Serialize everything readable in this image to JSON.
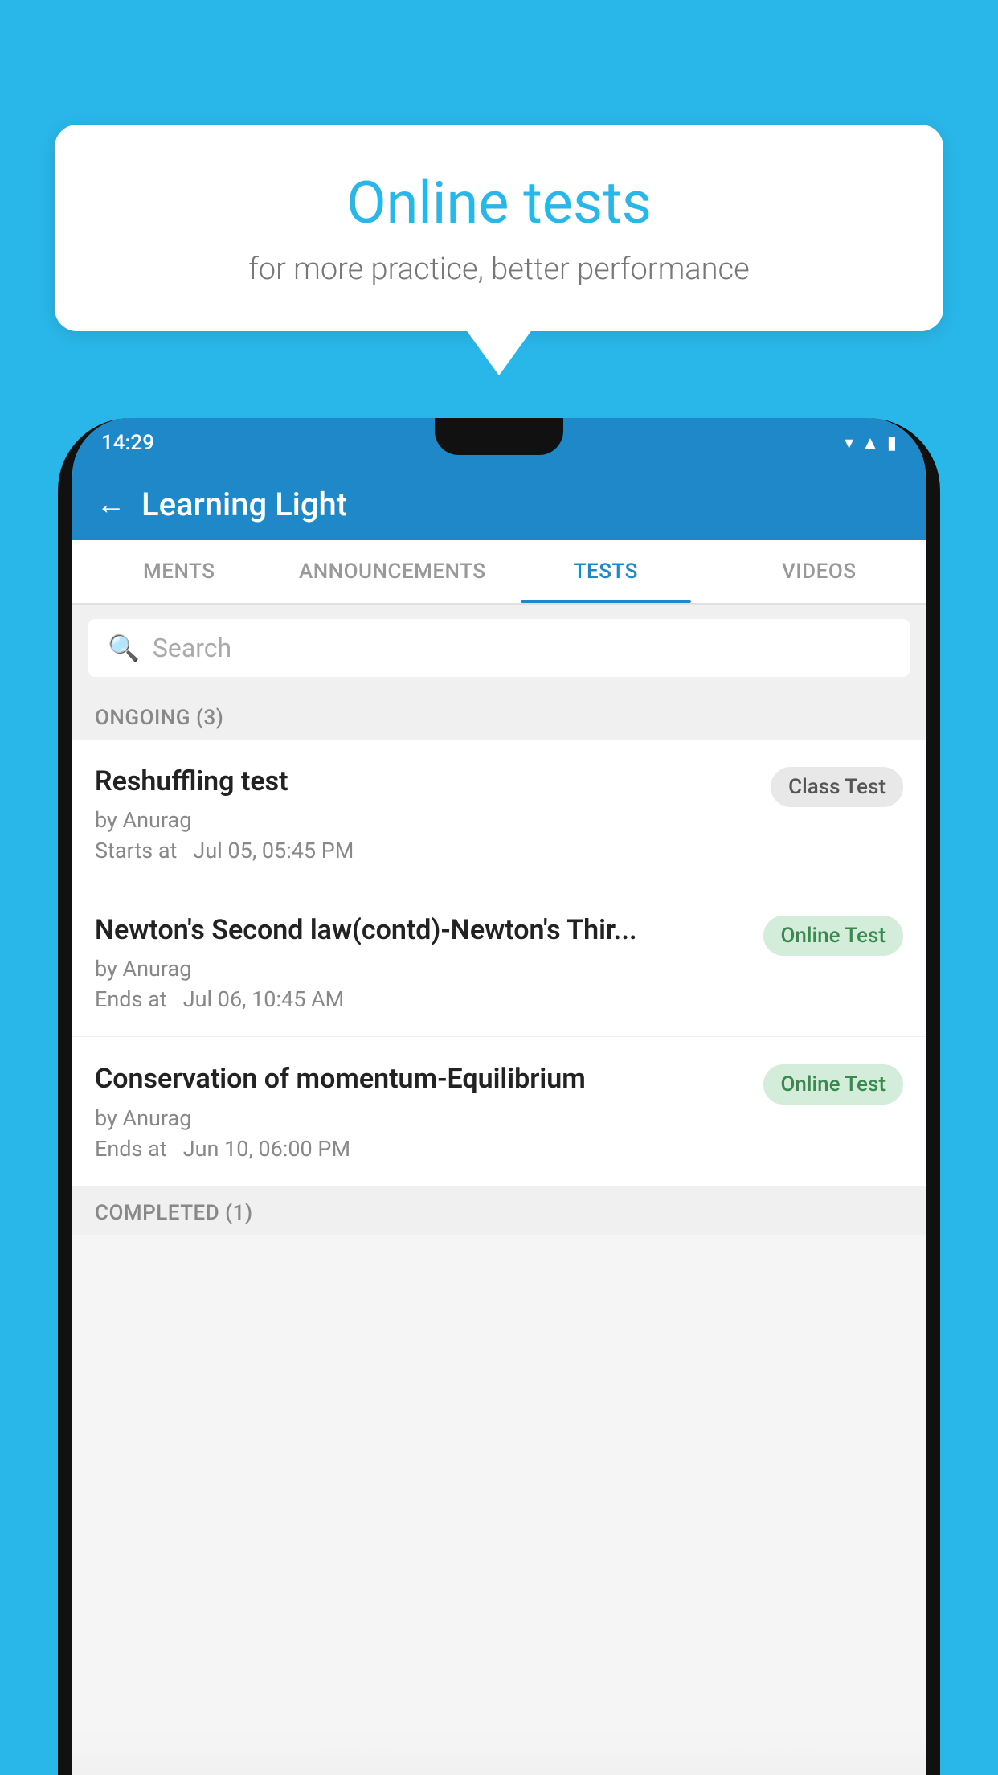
{
  "background_color": "#29B6E8",
  "speech_bubble": {
    "title": "Online tests",
    "subtitle": "for more practice, better performance"
  },
  "phone": {
    "status_bar": {
      "time": "14:29",
      "icons": [
        "wifi",
        "signal",
        "battery"
      ]
    },
    "app_bar": {
      "back_icon": "←",
      "title": "Learning Light"
    },
    "tabs": [
      {
        "label": "MENTS",
        "active": false
      },
      {
        "label": "ANNOUNCEMENTS",
        "active": false
      },
      {
        "label": "TESTS",
        "active": true
      },
      {
        "label": "VIDEOS",
        "active": false
      }
    ],
    "search": {
      "placeholder": "Search",
      "icon": "🔍"
    },
    "ongoing_section": {
      "header": "ONGOING (3)",
      "items": [
        {
          "name": "Reshuffling test",
          "author": "by Anurag",
          "date": "Starts at  Jul 05, 05:45 PM",
          "badge": "Class Test",
          "badge_type": "class"
        },
        {
          "name": "Newton's Second law(contd)-Newton's Thir...",
          "author": "by Anurag",
          "date": "Ends at  Jul 06, 10:45 AM",
          "badge": "Online Test",
          "badge_type": "online"
        },
        {
          "name": "Conservation of momentum-Equilibrium",
          "author": "by Anurag",
          "date": "Ends at  Jun 10, 06:00 PM",
          "badge": "Online Test",
          "badge_type": "online"
        }
      ]
    },
    "completed_section": {
      "header": "COMPLETED (1)"
    }
  }
}
